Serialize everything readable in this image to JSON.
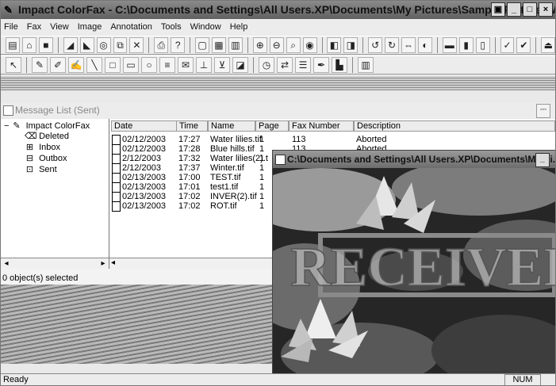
{
  "window": {
    "title": "Impact ColorFax - C:\\Documents and Settings\\All Users.XP\\Documents\\My Pictures\\Sample Pictures\\Water lilies.jpg",
    "buttons": [
      "_",
      "□",
      "×"
    ]
  },
  "menu": [
    "File",
    "Fax",
    "View",
    "Image",
    "Annotation",
    "Tools",
    "Window",
    "Help"
  ],
  "panel": {
    "title": "Message List (Sent)",
    "status": "0 object(s) selected"
  },
  "tree": {
    "root": "Impact ColorFax",
    "items": [
      "Deleted",
      "Inbox",
      "Outbox",
      "Sent"
    ]
  },
  "table": {
    "headers": [
      "Date",
      "Time",
      "Name",
      "Page",
      "Fax Number",
      "Description"
    ],
    "rows": [
      [
        "02/12/2003",
        "17:27",
        "Water lilies.tif",
        "1",
        "113",
        "Aborted"
      ],
      [
        "02/12/2003",
        "17:28",
        "Blue hills.tif",
        "1",
        "113",
        "Aborted"
      ],
      [
        "2/12/2003",
        "17:32",
        "Water lilies(2).t",
        "1",
        "",
        ""
      ],
      [
        "2/12/2003",
        "17:37",
        "Winter.tif",
        "1",
        "",
        ""
      ],
      [
        "02/13/2003",
        "17:00",
        "TEST.tif",
        "1",
        "",
        ""
      ],
      [
        "02/13/2003",
        "17:01",
        "test1.tif",
        "1",
        "",
        ""
      ],
      [
        "02/13/2003",
        "17:02",
        "INVER(2).tif",
        "1",
        "",
        ""
      ],
      [
        "02/13/2003",
        "17:02",
        "ROT.tif",
        "1",
        "",
        ""
      ]
    ]
  },
  "child_window": {
    "title": "C:\\Documents and Settings\\All Users.XP\\Documents\\My Pi...",
    "stamp": "RECEIVED"
  },
  "statusbar": {
    "left": "Ready",
    "num": "NUM"
  }
}
